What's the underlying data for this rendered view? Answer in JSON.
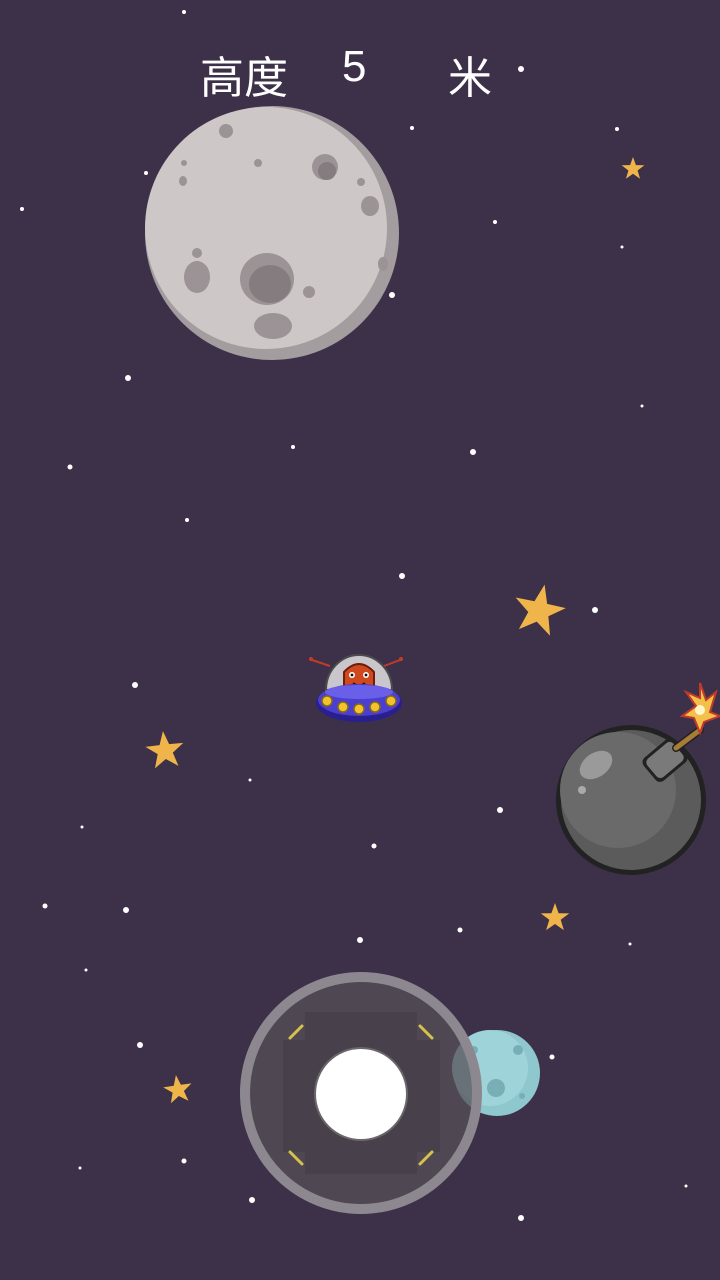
{
  "hud": {
    "altitude_label": "高度",
    "altitude_value": "5",
    "altitude_unit": "米"
  },
  "colors": {
    "background": "#3d3149",
    "star": "#f0b54a",
    "moon": "#cdc8c7",
    "moon_crater": "#928a8c",
    "bomb": "#5b5b5b",
    "ufo_body": "#4a3fd0",
    "alien": "#d0481e",
    "small_planet": "#8fc7cf"
  },
  "objects": {
    "moon": "moon-planet",
    "player": "ufo-alien-player",
    "bomb": "bomb-hazard",
    "planet": "small-teal-planet",
    "stars": "collectible-stars"
  },
  "controls": {
    "joystick": "virtual-joystick"
  }
}
